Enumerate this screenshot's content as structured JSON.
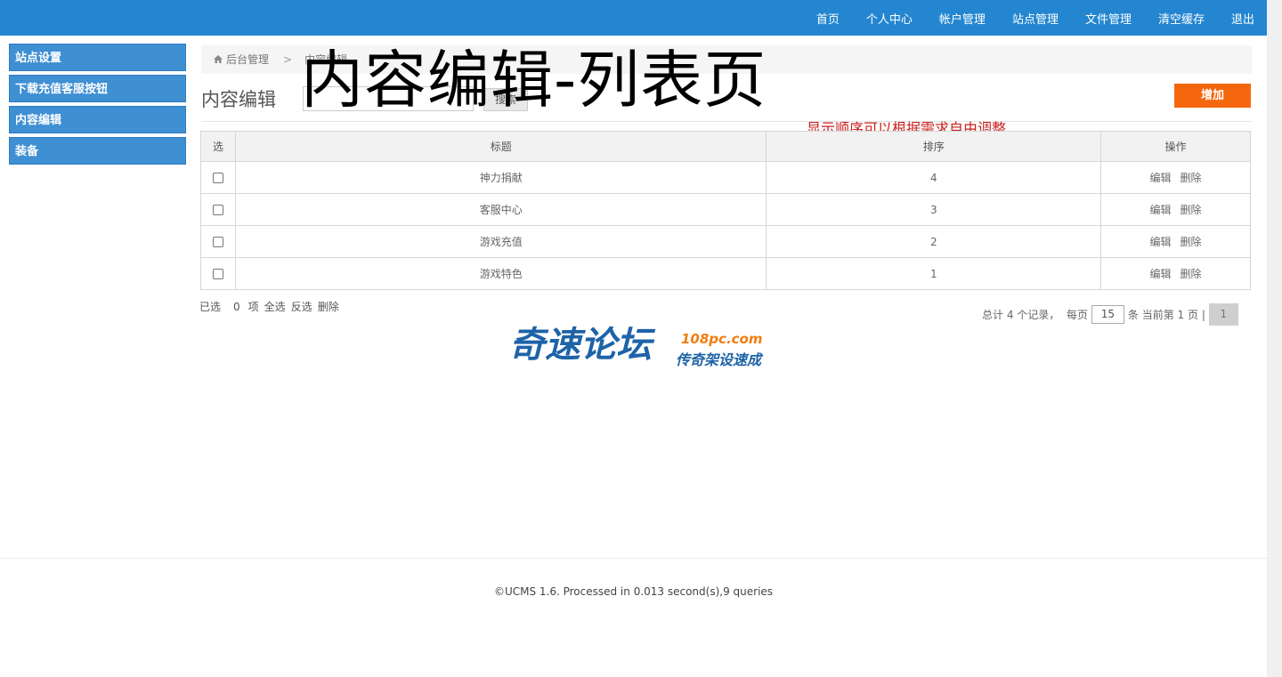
{
  "nav": {
    "items": [
      "首页",
      "个人中心",
      "帐户管理",
      "站点管理",
      "文件管理",
      "清空缓存",
      "退出"
    ]
  },
  "sidebar": {
    "items": [
      "站点设置",
      "下载充值客服按钮",
      "内容编辑",
      "装备"
    ]
  },
  "breadcrumb": {
    "home": "后台管理",
    "separator": ">",
    "current": "内容编辑"
  },
  "page": {
    "heading": "内容编辑",
    "search_button": "搜索",
    "overlay_title": "内容编辑-列表页",
    "add_button": "增加",
    "annotation": "显示顺序可以根据需求自由调整"
  },
  "table": {
    "headers": [
      "选",
      "标题",
      "排序",
      "操作"
    ],
    "rows": [
      {
        "title": "神力捐献",
        "sort": "4",
        "edit": "编辑",
        "delete": "删除"
      },
      {
        "title": "客服中心",
        "sort": "3",
        "edit": "编辑",
        "delete": "删除"
      },
      {
        "title": "游戏充值",
        "sort": "2",
        "edit": "编辑",
        "delete": "删除"
      },
      {
        "title": "游戏特色",
        "sort": "1",
        "edit": "编辑",
        "delete": "删除"
      }
    ]
  },
  "selection": {
    "selected_label": "已选",
    "count": "0",
    "unit": "项",
    "select_all": "全选",
    "invert": "反选",
    "delete": "删除"
  },
  "pager": {
    "total": "总计 4 个记录，",
    "per_page_label": "每页",
    "per_page_value": "15",
    "after": "条 当前第 1 页 |",
    "page": "1"
  },
  "watermark": {
    "main": "奇速论坛",
    "url": "108pc.com",
    "sub": "传奇架设速成"
  },
  "footer": {
    "text": "©UCMS 1.6. Processed in 0.013 second(s),9 queries"
  },
  "colors": {
    "topbar": "#2486d0",
    "sidebar": "#3f8fd3",
    "add_button": "#f5670d",
    "annotation": "#c8201e"
  }
}
